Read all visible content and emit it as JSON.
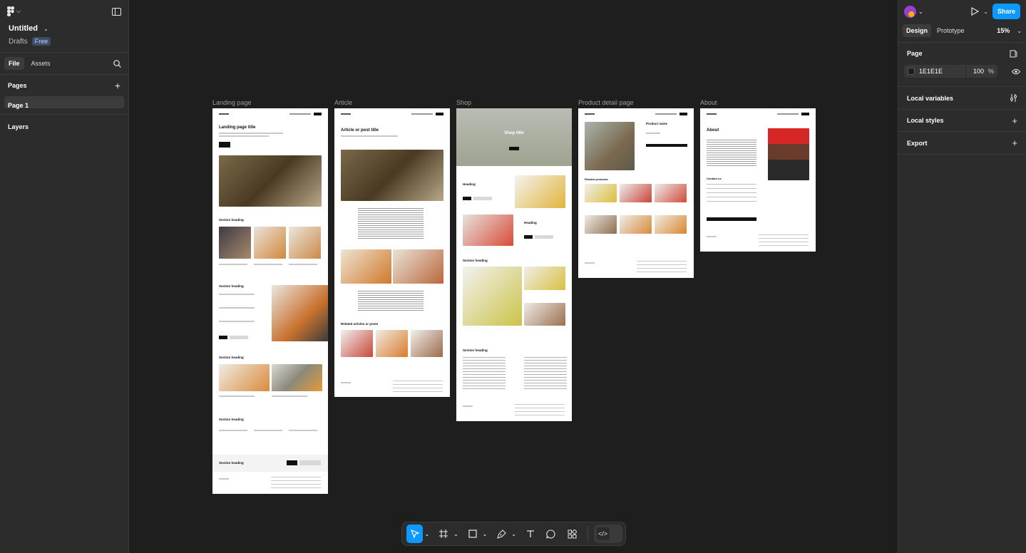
{
  "file": {
    "title": "Untitled",
    "location": "Drafts",
    "plan": "Free"
  },
  "left_tabs": {
    "file": "File",
    "assets": "Assets"
  },
  "pages": {
    "heading": "Pages",
    "items": [
      "Page 1"
    ]
  },
  "layers": {
    "heading": "Layers"
  },
  "frames": [
    {
      "title": "Landing page",
      "heading": "Landing page title",
      "sections": [
        "Section heading",
        "Section heading",
        "Section heading",
        "Section heading",
        "Section heading"
      ]
    },
    {
      "title": "Article",
      "heading": "Article or post title",
      "sections": [
        "Related articles or posts"
      ]
    },
    {
      "title": "Shop",
      "heading": "Shop title",
      "sections": [
        "Heading",
        "Heading",
        "Section heading",
        "Section heading"
      ]
    },
    {
      "title": "Product detail page",
      "heading": "Product name",
      "sections": [
        "Related products"
      ]
    },
    {
      "title": "About",
      "heading": "About",
      "sections": [
        "Contact us"
      ]
    }
  ],
  "right": {
    "share": "Share",
    "tabs": {
      "design": "Design",
      "prototype": "Prototype"
    },
    "zoom": "15%",
    "page_label": "Page",
    "page_color": "1E1E1E",
    "opacity": "100",
    "percent": "%",
    "local_variables": "Local variables",
    "local_styles": "Local styles",
    "export": "Export"
  },
  "help": "?",
  "colors": {
    "accent": "#0d99ff",
    "panel": "#2c2c2c",
    "canvas": "#1e1e1e"
  }
}
